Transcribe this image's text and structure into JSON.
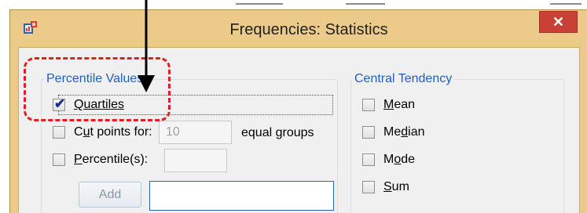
{
  "window": {
    "title": "Frequencies: Statistics",
    "close_label": "✕",
    "icon": "spss-app-icon",
    "frame_color": "#eccb8a",
    "close_color": "#c94136"
  },
  "percentile_values": {
    "legend": "Percentile Values",
    "quartiles": {
      "label": "Quartiles",
      "checked": true
    },
    "cut_points": {
      "label_prefix": "C",
      "label_underlined": "u",
      "label_suffix": "t points for:",
      "value": "10",
      "suffix": "equal groups",
      "checked": false
    },
    "percentiles": {
      "label_underlined": "P",
      "label_suffix": "ercentile(s):",
      "value": "",
      "checked": false
    },
    "add_button": "Add"
  },
  "central_tendency": {
    "legend": "Central Tendency",
    "items": [
      {
        "underlined": "M",
        "rest": "ean",
        "checked": false
      },
      {
        "pre": "Me",
        "underlined": "d",
        "rest": "ian",
        "checked": false
      },
      {
        "pre": "M",
        "underlined": "o",
        "rest": "de",
        "checked": false
      },
      {
        "underlined": "S",
        "rest": "um",
        "checked": false
      }
    ]
  },
  "annotations": {
    "callout_color": "#e02020",
    "arrow_color": "#000000"
  }
}
